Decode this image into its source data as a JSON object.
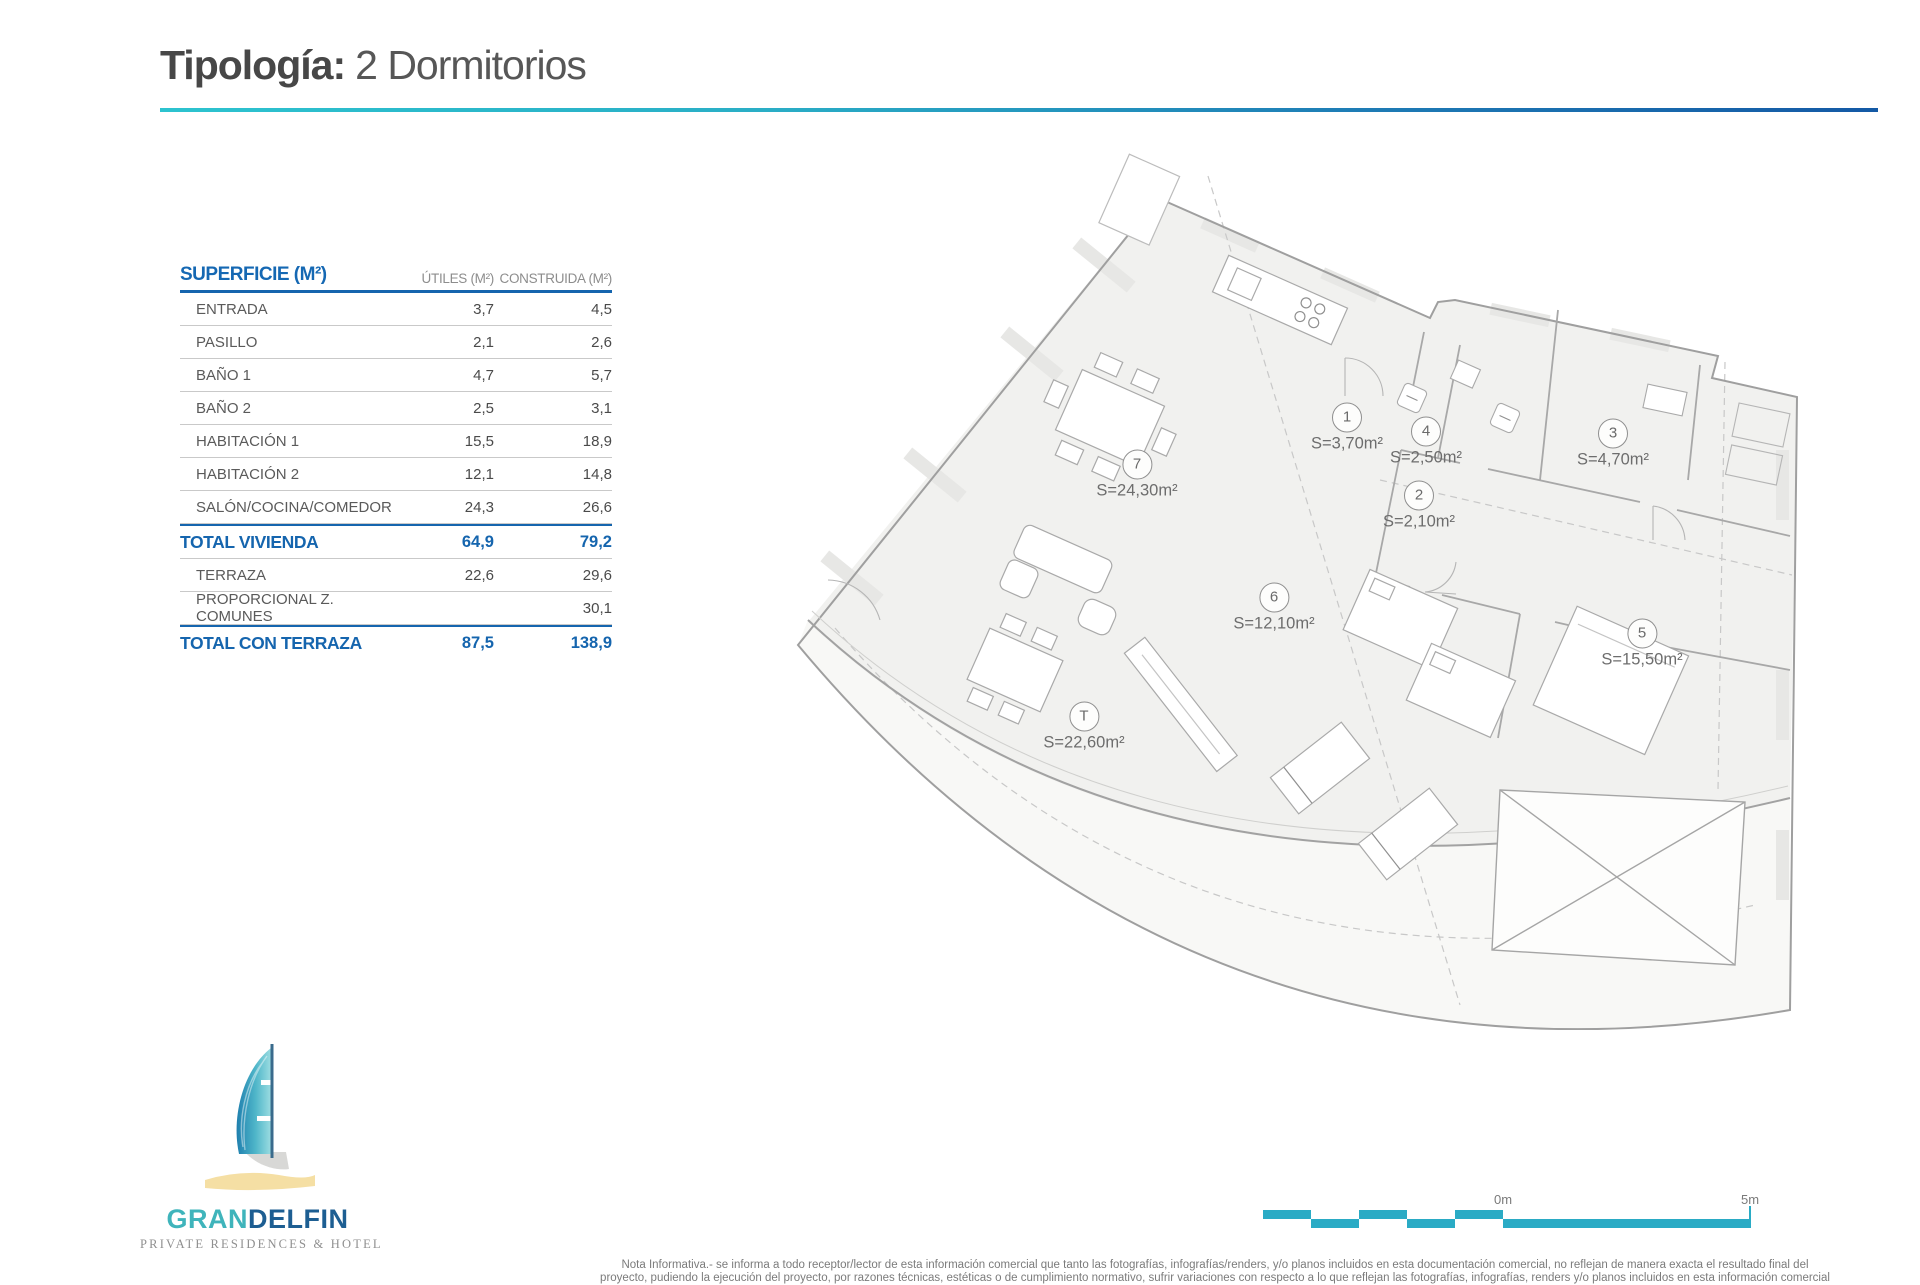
{
  "title": {
    "prefix": "Tipología:",
    "value": "2 Dormitorios"
  },
  "table": {
    "header": {
      "col1": "SUPERFICIE (M²)",
      "col2": "ÚTILES (M²)",
      "col3": "CONSTRUIDA (M²)"
    },
    "rows": [
      {
        "label": "ENTRADA",
        "utiles": "3,7",
        "construida": "4,5"
      },
      {
        "label": "PASILLO",
        "utiles": "2,1",
        "construida": "2,6"
      },
      {
        "label": "BAÑO 1",
        "utiles": "4,7",
        "construida": "5,7"
      },
      {
        "label": "BAÑO 2",
        "utiles": "2,5",
        "construida": "3,1"
      },
      {
        "label": "HABITACIÓN 1",
        "utiles": "15,5",
        "construida": "18,9"
      },
      {
        "label": "HABITACIÓN 2",
        "utiles": "12,1",
        "construida": "14,8"
      },
      {
        "label": "SALÓN/COCINA/COMEDOR",
        "utiles": "24,3",
        "construida": "26,6"
      }
    ],
    "total_vivienda": {
      "label": "TOTAL VIVIENDA",
      "utiles": "64,9",
      "construida": "79,2"
    },
    "extra_rows": [
      {
        "label": "TERRAZA",
        "utiles": "22,6",
        "construida": "29,6"
      },
      {
        "label": "PROPORCIONAL Z. COMUNES",
        "utiles": "",
        "construida": "30,1"
      }
    ],
    "total_con_terraza": {
      "label": "TOTAL CON TERRAZA",
      "utiles": "87,5",
      "construida": "138,9"
    }
  },
  "floorplan": {
    "rooms": [
      {
        "id": "1",
        "area": "S=3,70m²"
      },
      {
        "id": "2",
        "area": "S=2,10m²"
      },
      {
        "id": "3",
        "area": "S=4,70m²"
      },
      {
        "id": "4",
        "area": "S=2,50m²"
      },
      {
        "id": "5",
        "area": "S=15,50m²"
      },
      {
        "id": "6",
        "area": "S=12,10m²"
      },
      {
        "id": "7",
        "area": "S=24,30m²"
      },
      {
        "id": "T",
        "area": "S=22,60m²"
      }
    ]
  },
  "logo": {
    "brand_first": "GRAN",
    "brand_second": "DELFIN",
    "subtitle": "PRIVATE RESIDENCES & HOTEL"
  },
  "scalebar": {
    "start_label": "0m",
    "end_label": "5m"
  },
  "footer": {
    "line1": "Nota Informativa.- se informa a todo receptor/lector de esta información comercial que tanto las fotografías, infografías/renders, y/o planos incluidos en esta documentación comercial, no reflejan de manera exacta el resultado final del",
    "line2": "proyecto, pudiendo la ejecución del proyecto, por razones técnicas, estéticas o de cumplimiento normativo, sufrir variaciones con respecto a lo que reflejan las fotografías, infografías, renders y/o planos incluidos en esta información comercial"
  },
  "colors": {
    "accent_blue": "#1565ae",
    "accent_teal": "#2cc3cf",
    "scalebar_teal": "#2aabc5",
    "logo_teal": "#3fb4bb",
    "logo_blue": "#1d5e92",
    "sand": "#f5dfa4"
  }
}
